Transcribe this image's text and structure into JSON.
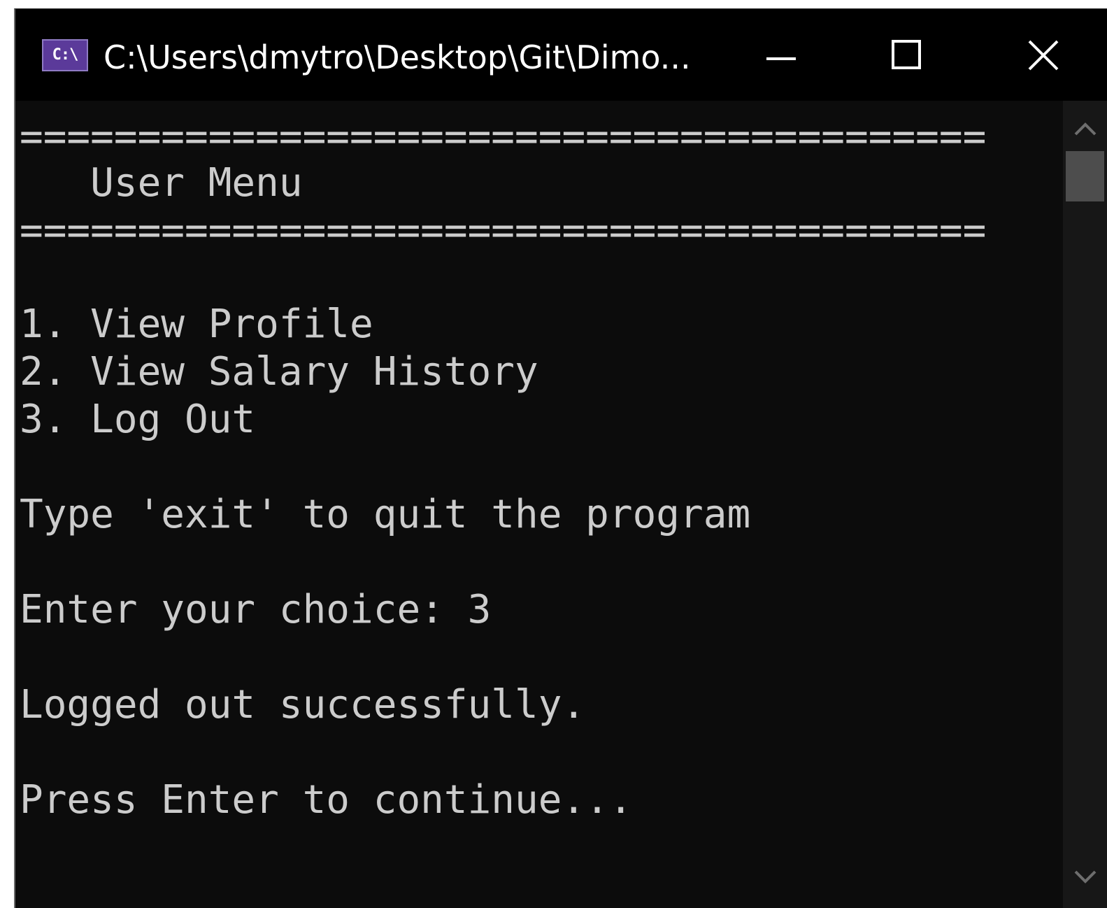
{
  "window": {
    "title": "C:\\Users\\dmytro\\Desktop\\Git\\Dimo...",
    "icon_label": "C:\\",
    "icon": "console-icon",
    "controls": {
      "minimize_icon": "minimize-icon",
      "maximize_icon": "maximize-icon",
      "close_icon": "close-icon"
    }
  },
  "terminal": {
    "lines": [
      "=========================================",
      "   User Menu",
      "=========================================",
      "",
      "1. View Profile",
      "2. View Salary History",
      "3. Log Out",
      "",
      "Type 'exit' to quit the program",
      "",
      "Enter your choice: 3",
      "",
      "Logged out successfully.",
      "",
      "Press Enter to continue..."
    ]
  },
  "scrollbar": {
    "up_icon": "chevron-up-icon",
    "down_icon": "chevron-down-icon"
  },
  "colors": {
    "terminal_background": "#0c0c0c",
    "terminal_text": "#cccccc",
    "titlebar_background": "#000000",
    "icon_background": "#5b3a9a"
  }
}
